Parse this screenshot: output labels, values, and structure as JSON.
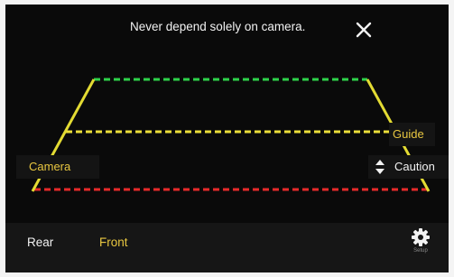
{
  "banner": {
    "warning_text": "Never depend solely on camera.",
    "close_icon": "close-icon"
  },
  "overlay": {
    "guide_label": "Guide",
    "camera_label": "Camera",
    "caution_label": "Caution",
    "caution_icon": "up-down-arrow-icon"
  },
  "guide_colors": {
    "near": "#e62a2a",
    "middle": "#ecdf3a",
    "far": "#2ed24a",
    "sides": "#e3db33"
  },
  "bottom_bar": {
    "rear_label": "Rear",
    "front_label": "Front",
    "settings_label": "Setup",
    "settings_icon": "gear-icon"
  },
  "colors": {
    "accent": "#e8c640",
    "text": "#f2f2f2",
    "background": "#0a0a0a"
  }
}
